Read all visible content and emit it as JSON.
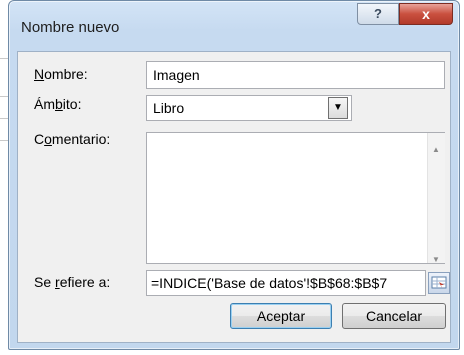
{
  "dialog": {
    "title": "Nombre nuevo",
    "help_label": "?",
    "close_label": "x"
  },
  "form": {
    "name_label_pre": "",
    "name_label_u": "N",
    "name_label_post": "ombre:",
    "name_value": "Imagen",
    "scope_label_pre": "Ám",
    "scope_label_u": "b",
    "scope_label_post": "ito:",
    "scope_value": "Libro",
    "comment_label_pre": "C",
    "comment_label_u": "o",
    "comment_label_post": "mentario:",
    "comment_value": "",
    "refers_label_pre": "Se ",
    "refers_label_u": "r",
    "refers_label_post": "efiere a:",
    "refers_value": "=INDICE('Base de datos'!$B$68:$B$7"
  },
  "buttons": {
    "ok": "Aceptar",
    "cancel": "Cancelar"
  },
  "icons": {
    "dropdown": "chevron-down-icon",
    "range_selector": "range-select-icon",
    "scroll_up": "scroll-up-icon",
    "scroll_down": "scroll-down-icon"
  }
}
